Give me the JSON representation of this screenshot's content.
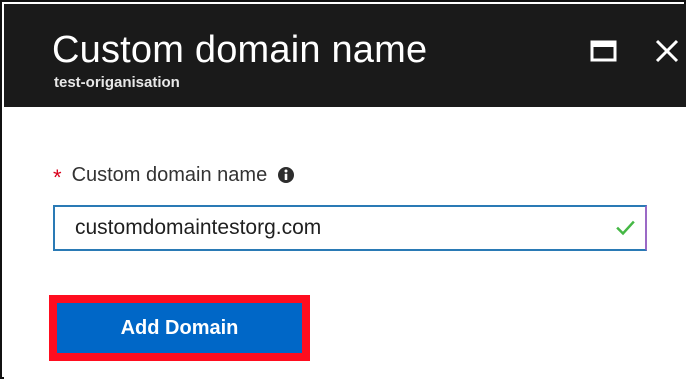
{
  "blade": {
    "title": "Custom domain name",
    "subtitle": "test-origanisation",
    "maximize_icon": "maximize-icon",
    "close_icon": "close-icon"
  },
  "form": {
    "required_marker": "*",
    "field_label": "Custom domain name",
    "info_icon": "info-icon",
    "field_value": "customdomaintestorg.com",
    "validation_icon": "checkmark-icon",
    "submit_label": "Add Domain"
  },
  "colors": {
    "header_background": "#1a1a1a",
    "button_background": "#0067c7",
    "highlight_outline": "#ff0d1f",
    "valid": "#45b845",
    "required": "#d9001b"
  }
}
